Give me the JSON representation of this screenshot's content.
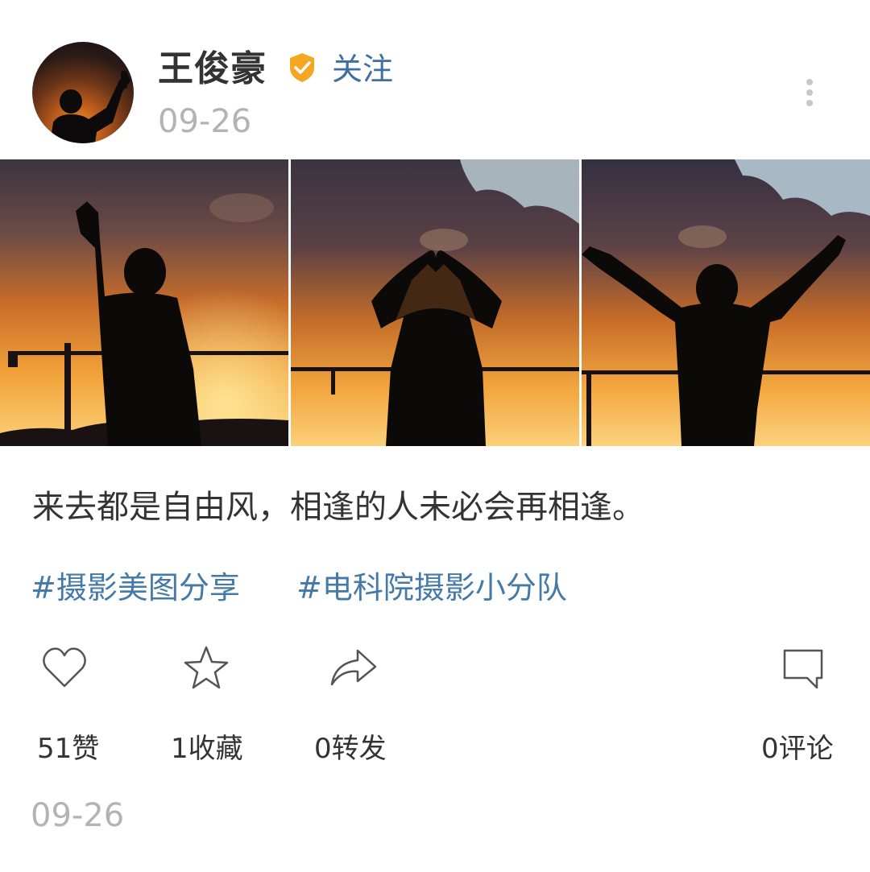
{
  "post": {
    "author": {
      "name": "王俊豪",
      "verified_icon": "verified-badge-icon",
      "follow_label": "关注"
    },
    "date": "09-26",
    "images": [
      {
        "icon": "photo-silhouette-raised-hand"
      },
      {
        "icon": "photo-silhouette-heart-hands"
      },
      {
        "icon": "photo-silhouette-open-arms"
      }
    ],
    "caption": "来去都是自由风，相逢的人未必会再相逢。",
    "topics": [
      "#摄影美图分享",
      "#电科院摄影小分队"
    ],
    "actions": {
      "like": {
        "icon": "heart-icon",
        "label": "51赞"
      },
      "collect": {
        "icon": "star-icon",
        "label": "1收藏"
      },
      "repost": {
        "icon": "share-arrow-icon",
        "label": "0转发"
      },
      "comment": {
        "icon": "comment-bubble-icon",
        "label": "0评论"
      }
    },
    "footer_date": "09-26"
  },
  "colors": {
    "link": "#3f6ea0",
    "topic": "#4479a8",
    "verified": "#f5a623",
    "muted_text": "#b3b3b3",
    "body_text": "#333333"
  }
}
